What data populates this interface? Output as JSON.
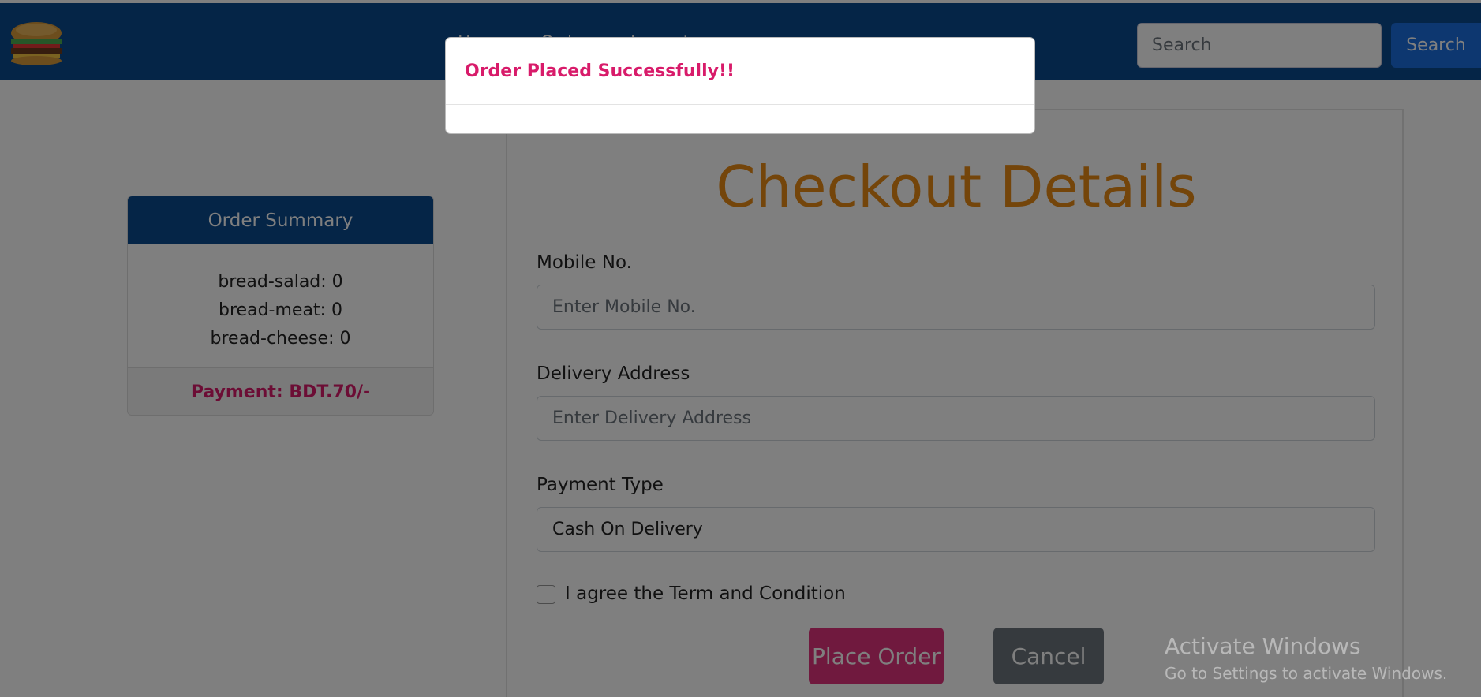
{
  "navbar": {
    "links": [
      "Home",
      "Orders",
      "Logout"
    ],
    "search_placeholder": "Search",
    "search_button": "Search"
  },
  "summary": {
    "title": "Order Summary",
    "items": [
      "bread-salad: 0",
      "bread-meat: 0",
      "bread-cheese: 0"
    ],
    "payment": "Payment: BDT.70/-"
  },
  "checkout": {
    "title": "Checkout Details",
    "mobile_label": "Mobile No.",
    "mobile_placeholder": "Enter Mobile No.",
    "address_label": "Delivery Address",
    "address_placeholder": "Enter Delivery Address",
    "payment_label": "Payment Type",
    "payment_value": "Cash On Delivery",
    "agree_label": "I agree the Term and Condition",
    "place_button": "Place Order",
    "cancel_button": "Cancel"
  },
  "modal": {
    "message": "Order Placed Successfully!!"
  },
  "watermark": {
    "title": "Activate Windows",
    "subtitle": "Go to Settings to activate Windows."
  },
  "colors": {
    "navbar": "#0a4a8f",
    "title_orange": "#e88a14",
    "accent_pink": "#d81b6a",
    "search_blue": "#1a6fe0"
  }
}
